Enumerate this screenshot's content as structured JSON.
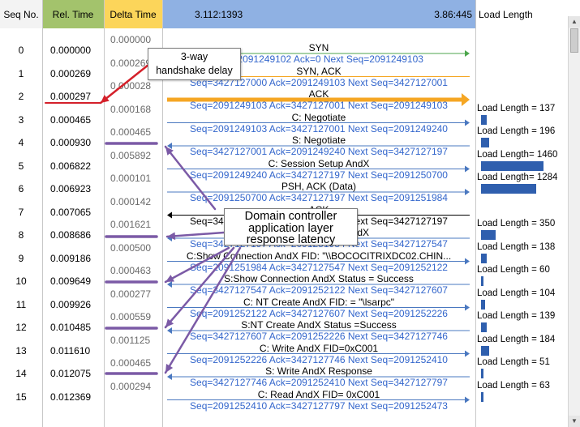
{
  "header": {
    "seq": "Seq No.",
    "rel": "Rel. Time",
    "delta": "Delta Time",
    "left_host": "3.112:1393",
    "right_host": "3.86:445",
    "load": "Load Length"
  },
  "colors": {
    "rel_header": "#a3c36c",
    "delta_header": "#fcd55a",
    "flow_header": "#8fb1e3",
    "arrow_blue": "#4a78c0",
    "arrow_green": "#4ca64c",
    "arrow_orange": "#f5a623",
    "seq_blue": "#3366cc",
    "annotation_purple": "#7b5aa6",
    "annotation_red": "#d4202a",
    "load_bar": "#2f5fae"
  },
  "rows": [
    {
      "seq": "0",
      "rel": "0.000000",
      "delta": "0.000000"
    },
    {
      "seq": "1",
      "rel": "0.000269",
      "delta": "0.000269"
    },
    {
      "seq": "2",
      "rel": "0.000297",
      "delta": "0.000028"
    },
    {
      "seq": "3",
      "rel": "0.000465",
      "delta": "0.000168"
    },
    {
      "seq": "4",
      "rel": "0.000930",
      "delta": "0.000465"
    },
    {
      "seq": "5",
      "rel": "0.006822",
      "delta": "0.005892"
    },
    {
      "seq": "6",
      "rel": "0.006923",
      "delta": "0.000101"
    },
    {
      "seq": "7",
      "rel": "0.007065",
      "delta": "0.000142"
    },
    {
      "seq": "8",
      "rel": "0.008686",
      "delta": "0.001621"
    },
    {
      "seq": "9",
      "rel": "0.009186",
      "delta": "0.000500"
    },
    {
      "seq": "10",
      "rel": "0.009649",
      "delta": "0.000463"
    },
    {
      "seq": "11",
      "rel": "0.009926",
      "delta": "0.000277"
    },
    {
      "seq": "12",
      "rel": "0.010485",
      "delta": "0.000559"
    },
    {
      "seq": "13",
      "rel": "0.011610",
      "delta": "0.001125"
    },
    {
      "seq": "14",
      "rel": "0.012075",
      "delta": "0.000465"
    },
    {
      "seq": "15",
      "rel": "0.012369",
      "delta": "0.000294"
    }
  ],
  "flow": [
    {
      "label": "SYN",
      "seq": "Seq=2091249102  Ack=0  Next Seq=2091249103",
      "dir": "right",
      "style": "green"
    },
    {
      "label": "SYN, ACK",
      "seq": "Seq=3427127000  Ack=2091249103  Next Seq=3427127001",
      "dir": "left",
      "style": "orange-thin"
    },
    {
      "label": "ACK",
      "seq": "Seq=2091249103  Ack=3427127001  Next Seq=2091249103",
      "dir": "right",
      "style": "orange-thick"
    },
    {
      "label": "C: Negotiate",
      "seq": "Seq=2091249103  Ack=3427127001  Next Seq=2091249240",
      "dir": "right",
      "style": "blue"
    },
    {
      "label": "S: Negotiate",
      "seq": "Seq=3427127001  Ack=2091249240  Next Seq=3427127197",
      "dir": "left",
      "style": "blue"
    },
    {
      "label": "C: Session Setup AndX",
      "seq": "Seq=2091249240  Ack=3427127197  Next Seq=2091250700",
      "dir": "right",
      "style": "blue"
    },
    {
      "label": "PSH, ACK (Data)",
      "seq": "Seq=2091250700  Ack=3427127197  Next Seq=2091251984",
      "dir": "right",
      "style": "blue"
    },
    {
      "label": "ACK",
      "seq": "Seq=3427127197  Ack=2091251984  Next Seq=3427127197",
      "dir": "left",
      "style": "black"
    },
    {
      "label": "S: Session Setup AndX",
      "seq": "Seq=3427127197  Ack=2091251984  Next Seq=3427127547",
      "dir": "left",
      "style": "blue"
    },
    {
      "label": "C:Show Connection AndX FID:  \"\\\\BOCOCITRIXDC02.CHIN...",
      "seq": "Seq=2091251984  Ack=3427127547  Next Seq=2091252122",
      "dir": "right",
      "style": "blue"
    },
    {
      "label": "S:Show Connection AndX Status = Success",
      "seq": "Seq=3427127547  Ack=2091252122  Next Seq=3427127607",
      "dir": "left",
      "style": "blue"
    },
    {
      "label": "C:  NT Create AndX FID:  =  \"\\lsarpc\"",
      "seq": "Seq=2091252122  Ack=3427127607  Next Seq=2091252226",
      "dir": "right",
      "style": "blue"
    },
    {
      "label": "S:NT Create AndX Status =Success",
      "seq": "Seq=3427127607  Ack=2091252226  Next Seq=3427127746",
      "dir": "left",
      "style": "blue"
    },
    {
      "label": "C: Write AndX  FID=0xC001",
      "seq": "Seq=2091252226  Ack=3427127746  Next Seq=2091252410",
      "dir": "right",
      "style": "blue"
    },
    {
      "label": "S:  Write AndX  Response",
      "seq": "Seq=3427127746  Ack=2091252410  Next Seq=3427127797",
      "dir": "left",
      "style": "blue"
    },
    {
      "label": "C: Read AndX  FID= 0xC001",
      "seq": "Seq=2091252410  Ack=3427127797  Next Seq=2091252473",
      "dir": "right",
      "style": "blue"
    }
  ],
  "loads": [
    {
      "row": 3,
      "text": "Load Length = 137",
      "value": 137
    },
    {
      "row": 4,
      "text": "Load Length = 196",
      "value": 196
    },
    {
      "row": 5,
      "text": "Load Length= 1460",
      "value": 1460
    },
    {
      "row": 6,
      "text": "Load Length= 1284",
      "value": 1284
    },
    {
      "row": 8,
      "text": "Load Length = 350",
      "value": 350
    },
    {
      "row": 9,
      "text": "Load Length = 138",
      "value": 138
    },
    {
      "row": 10,
      "text": "Load Length = 60",
      "value": 60
    },
    {
      "row": 11,
      "text": "Load Length = 104",
      "value": 104
    },
    {
      "row": 12,
      "text": "Load Length = 139",
      "value": 139
    },
    {
      "row": 13,
      "text": "Load Length = 184",
      "value": 184
    },
    {
      "row": 14,
      "text": "Load Length = 51",
      "value": 51
    },
    {
      "row": 15,
      "text": "Load Length = 63",
      "value": 63
    }
  ],
  "callouts": {
    "handshake": {
      "line1": "3-way",
      "line2": "handshake delay"
    },
    "dc": {
      "line1": "Domain controller",
      "line2": "application layer",
      "line3": "response latency"
    }
  },
  "scrollbar": {
    "up_icon": "▲",
    "down_icon": "▼"
  }
}
